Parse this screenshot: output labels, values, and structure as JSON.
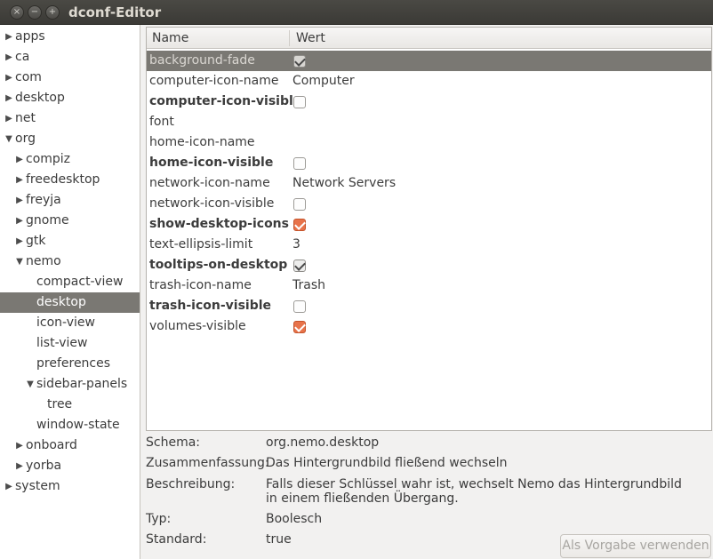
{
  "window": {
    "title": "dconf-Editor",
    "close_glyph": "×",
    "min_glyph": "−",
    "max_glyph": "+"
  },
  "tree": [
    {
      "label": "apps",
      "expander": "right",
      "depth": 0,
      "selected": false
    },
    {
      "label": "ca",
      "expander": "right",
      "depth": 0,
      "selected": false
    },
    {
      "label": "com",
      "expander": "right",
      "depth": 0,
      "selected": false
    },
    {
      "label": "desktop",
      "expander": "right",
      "depth": 0,
      "selected": false
    },
    {
      "label": "net",
      "expander": "right",
      "depth": 0,
      "selected": false
    },
    {
      "label": "org",
      "expander": "down",
      "depth": 0,
      "selected": false
    },
    {
      "label": "compiz",
      "expander": "right",
      "depth": 1,
      "selected": false
    },
    {
      "label": "freedesktop",
      "expander": "right",
      "depth": 1,
      "selected": false
    },
    {
      "label": "freyja",
      "expander": "right",
      "depth": 1,
      "selected": false
    },
    {
      "label": "gnome",
      "expander": "right",
      "depth": 1,
      "selected": false
    },
    {
      "label": "gtk",
      "expander": "right",
      "depth": 1,
      "selected": false
    },
    {
      "label": "nemo",
      "expander": "down",
      "depth": 1,
      "selected": false
    },
    {
      "label": "compact-view",
      "expander": "none",
      "depth": 2,
      "selected": false
    },
    {
      "label": "desktop",
      "expander": "none",
      "depth": 2,
      "selected": true
    },
    {
      "label": "icon-view",
      "expander": "none",
      "depth": 2,
      "selected": false
    },
    {
      "label": "list-view",
      "expander": "none",
      "depth": 2,
      "selected": false
    },
    {
      "label": "preferences",
      "expander": "none",
      "depth": 2,
      "selected": false
    },
    {
      "label": "sidebar-panels",
      "expander": "down",
      "depth": 2,
      "selected": false
    },
    {
      "label": "tree",
      "expander": "none",
      "depth": 3,
      "selected": false
    },
    {
      "label": "window-state",
      "expander": "none",
      "depth": 2,
      "selected": false
    },
    {
      "label": "onboard",
      "expander": "right",
      "depth": 1,
      "selected": false
    },
    {
      "label": "yorba",
      "expander": "right",
      "depth": 1,
      "selected": false
    },
    {
      "label": "system",
      "expander": "right",
      "depth": 0,
      "selected": false
    }
  ],
  "list": {
    "columns": {
      "name": "Name",
      "value": "Wert"
    },
    "rows": [
      {
        "name": "background-fade",
        "type": "check",
        "checked": true,
        "modified": false,
        "selected": true,
        "highlight": false,
        "accent": false,
        "value": ""
      },
      {
        "name": "computer-icon-name",
        "type": "text",
        "value": "Computer",
        "modified": false,
        "selected": false,
        "highlight": false
      },
      {
        "name": "computer-icon-visible",
        "type": "check",
        "checked": false,
        "modified": true,
        "selected": false,
        "highlight": true,
        "accent": false,
        "value": ""
      },
      {
        "name": "font",
        "type": "text",
        "value": "",
        "modified": false,
        "selected": false,
        "highlight": false
      },
      {
        "name": "home-icon-name",
        "type": "text",
        "value": "",
        "modified": false,
        "selected": false,
        "highlight": false
      },
      {
        "name": "home-icon-visible",
        "type": "check",
        "checked": false,
        "modified": true,
        "selected": false,
        "highlight": true,
        "accent": false,
        "value": ""
      },
      {
        "name": "network-icon-name",
        "type": "text",
        "value": "Network Servers",
        "modified": false,
        "selected": false,
        "highlight": false
      },
      {
        "name": "network-icon-visible",
        "type": "check",
        "checked": false,
        "modified": false,
        "selected": false,
        "highlight": false,
        "accent": false,
        "value": ""
      },
      {
        "name": "show-desktop-icons",
        "type": "check",
        "checked": true,
        "modified": true,
        "selected": false,
        "highlight": true,
        "accent": true,
        "value": ""
      },
      {
        "name": "text-ellipsis-limit",
        "type": "text",
        "value": "3",
        "modified": false,
        "selected": false,
        "highlight": false
      },
      {
        "name": "tooltips-on-desktop",
        "type": "check",
        "checked": true,
        "modified": true,
        "selected": false,
        "highlight": false,
        "accent": false,
        "value": ""
      },
      {
        "name": "trash-icon-name",
        "type": "text",
        "value": "Trash",
        "modified": false,
        "selected": false,
        "highlight": false
      },
      {
        "name": "trash-icon-visible",
        "type": "check",
        "checked": false,
        "modified": true,
        "selected": false,
        "highlight": true,
        "accent": false,
        "value": ""
      },
      {
        "name": "volumes-visible",
        "type": "check",
        "checked": true,
        "modified": false,
        "selected": false,
        "highlight": true,
        "accent": true,
        "value": ""
      }
    ]
  },
  "details": {
    "schema_label": "Schema:",
    "schema_value": "org.nemo.desktop",
    "summary_label": "Zusammenfassung:",
    "summary_value": "Das Hintergrundbild fließend wechseln",
    "description_label": "Beschreibung:",
    "description_value": "Falls dieser Schlüssel wahr ist, wechselt Nemo das Hintergrundbild in einem fließenden Übergang.",
    "type_label": "Typ:",
    "type_value": "Boolesch",
    "default_label": "Standard:",
    "default_value": "true"
  },
  "default_button": {
    "label": "Als Vorgabe verwenden",
    "enabled": false
  },
  "colors": {
    "selection": "#7a7873",
    "accent_check": "#e8734a",
    "titlebar": "#3b3a36"
  }
}
